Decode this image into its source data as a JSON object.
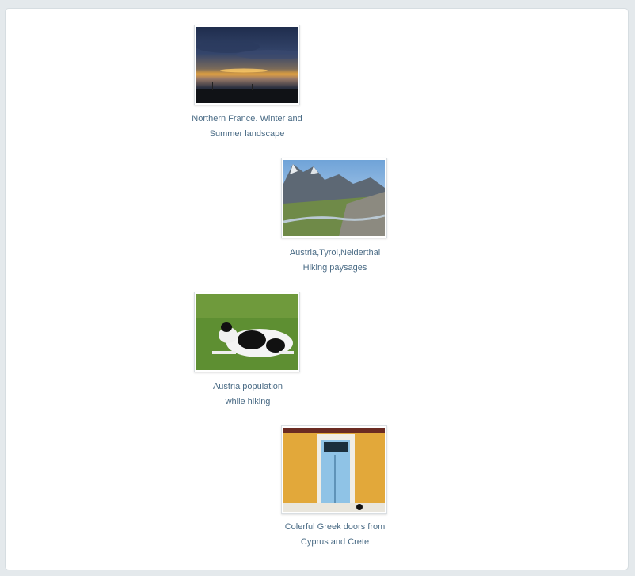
{
  "gallery": {
    "items": [
      {
        "image_icon": "sunset-landscape-image",
        "caption_line1": "Northern France. Winter and",
        "caption_line2": "Summer landscape"
      },
      {
        "image_icon": "mountain-valley-image",
        "caption_line1": "Austria,Tyrol,Neiderthai",
        "caption_line2": "Hiking paysages"
      },
      {
        "image_icon": "cow-on-grass-image",
        "caption_line1": "Austria population",
        "caption_line2": "while hiking"
      },
      {
        "image_icon": "blue-door-image",
        "caption_line1": "Colerful Greek doors from",
        "caption_line2": "Cyprus and Crete"
      }
    ]
  }
}
